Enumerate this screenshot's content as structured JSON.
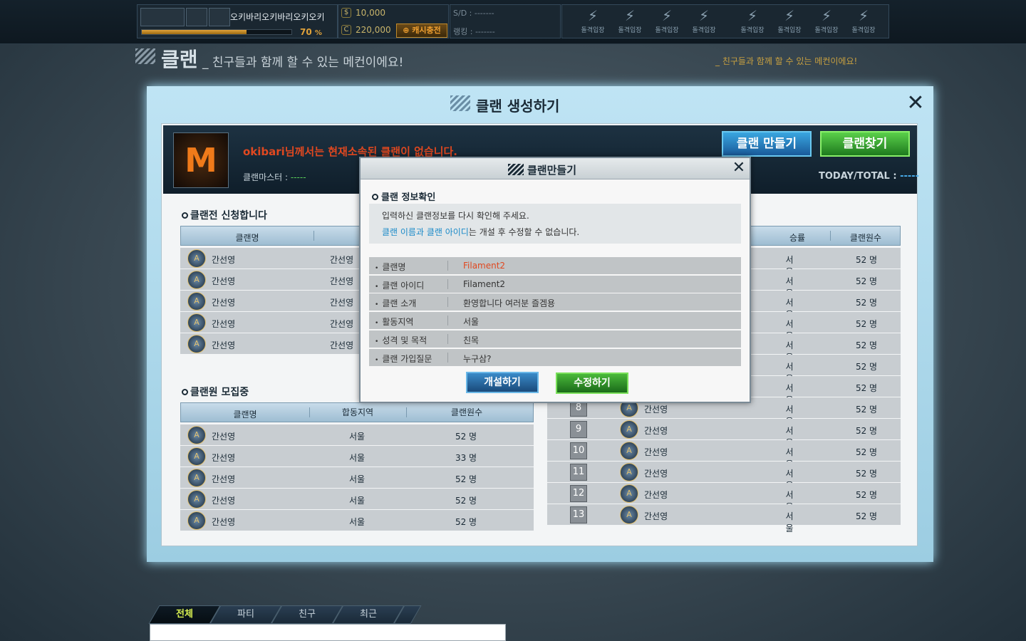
{
  "topbar": {
    "nickname": "오키바리오키바리오키오키",
    "exp_percent": 70,
    "exp_label": "70",
    "exp_unit": "%",
    "money_icon": "$",
    "money": "10,000",
    "cash_icon": "C",
    "cash": "220,000",
    "cash_button": "⊕ 캐시충전",
    "sd": "S/D : -------",
    "ranking": "랭킹 : -------",
    "quick_icon": "lightning-icon",
    "quick_items": [
      "돌격입장",
      "돌격입장",
      "돌격입장",
      "돌격입장",
      "돌격입장",
      "돌격입장",
      "돌격입장",
      "돌격입장"
    ]
  },
  "page": {
    "title": "클랜",
    "subtitle": "_ 친구들과 함께 할 수 있는 메컨이에요!",
    "subtitle_right": "_ 친구들과 함께 할 수 있는 메컨이에요!"
  },
  "panel": {
    "title": "클랜 생성하기",
    "close": "✕",
    "logo_letter": "M",
    "no_clan_msg": "okibari님께서는 현재소속된 클랜이 없습니다.",
    "master_label": "클랜마스터 : ",
    "master_value": "-----",
    "today_label": "TODAY/TOTAL : ",
    "today_value": "-----",
    "make_button": "클랜 만들기",
    "find_button": "클랜찾기"
  },
  "war": {
    "title": "클랜전 신청합니다",
    "header_name": "클랜명",
    "rows": [
      {
        "name": "간선영",
        "col2": "간선영"
      },
      {
        "name": "간선영",
        "col2": "간선영"
      },
      {
        "name": "간선영",
        "col2": "간선영"
      },
      {
        "name": "간선영",
        "col2": "간선영"
      },
      {
        "name": "간선영",
        "col2": "간선영"
      }
    ]
  },
  "recruit": {
    "title": "클랜원 모집중",
    "headers": [
      "클랜명",
      "합동지역",
      "클랜원수"
    ],
    "rows": [
      {
        "name": "간선영",
        "region": "서울",
        "members": "52 명"
      },
      {
        "name": "간선영",
        "region": "서울",
        "members": "33 명"
      },
      {
        "name": "간선영",
        "region": "서울",
        "members": "52 명"
      },
      {
        "name": "간선영",
        "region": "서울",
        "members": "52 명"
      },
      {
        "name": "간선영",
        "region": "서울",
        "members": "52 명"
      }
    ]
  },
  "ranking": {
    "headers": [
      "승률",
      "클랜원수"
    ],
    "rows_top": [
      {
        "region": "서울",
        "members": "52 명"
      },
      {
        "region": "서울",
        "members": "52 명"
      },
      {
        "region": "서울",
        "members": "52 명"
      },
      {
        "region": "서울",
        "members": "52 명"
      },
      {
        "region": "서울",
        "members": "52 명"
      },
      {
        "region": "서울",
        "members": "52 명"
      },
      {
        "region": "서울",
        "members": "52 명"
      }
    ],
    "rows": [
      {
        "rank": "8",
        "name": "간선영",
        "region": "서울",
        "members": "52 명"
      },
      {
        "rank": "9",
        "name": "간선영",
        "region": "서울",
        "members": "52 명"
      },
      {
        "rank": "10",
        "name": "간선영",
        "region": "서울",
        "members": "52 명"
      },
      {
        "rank": "11",
        "name": "간선영",
        "region": "서울",
        "members": "52 명"
      },
      {
        "rank": "12",
        "name": "간선영",
        "region": "서울",
        "members": "52 명"
      },
      {
        "rank": "13",
        "name": "간선영",
        "region": "서울",
        "members": "52 명"
      }
    ]
  },
  "modal": {
    "title": "클랜만들기",
    "close": "✕",
    "section": "클랜 정보확인",
    "notice1": "입력하신 클랜정보를 다시 확인해 주세요.",
    "notice2_highlight": "클랜 이름과 클랜 아이디",
    "notice2_rest": "는 개설 후 수정할 수 없습니다.",
    "fields": [
      {
        "label": "클랜명",
        "value": "Filament2"
      },
      {
        "label": "클랜 아이디",
        "value": "Filament2"
      },
      {
        "label": "클랜 소개",
        "value": "환영합니다 여러분 즐겜용"
      },
      {
        "label": "활동지역",
        "value": "서울"
      },
      {
        "label": "성격 및 목적",
        "value": "친목"
      },
      {
        "label": "클랜 가입질문",
        "value": "누구삼?"
      }
    ],
    "open_button": "개설하기",
    "edit_button": "수정하기"
  },
  "chat": {
    "tabs": [
      "전체",
      "파티",
      "친구",
      "최근"
    ],
    "active_tab": "전체"
  },
  "colors": {
    "accent_orange": "#e04820",
    "accent_blue": "#1a8ac8",
    "gold": "#e0a23a",
    "green": "#5ad05a"
  }
}
